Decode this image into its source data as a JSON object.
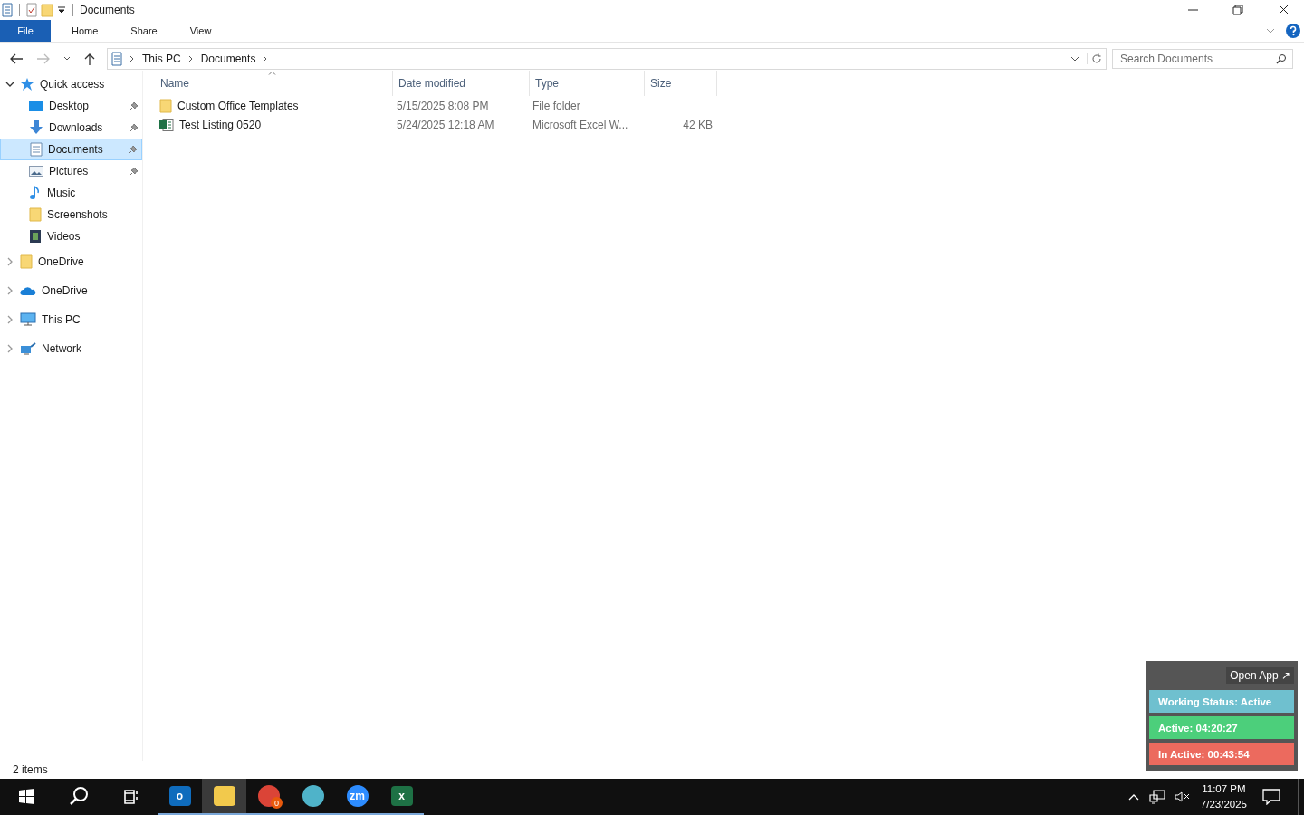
{
  "window": {
    "title": "Documents"
  },
  "ribbon_tabs": [
    {
      "label": "File",
      "kind": "file",
      "selected": false
    },
    {
      "label": "Home",
      "kind": "tab",
      "selected": false
    },
    {
      "label": "Share",
      "kind": "tab",
      "selected": false
    },
    {
      "label": "View",
      "kind": "tab",
      "selected": false
    }
  ],
  "breadcrumb": [
    "This PC",
    "Documents"
  ],
  "search": {
    "placeholder": "Search Documents"
  },
  "sidebar": {
    "items": [
      {
        "label": "Quick access",
        "kind": "star",
        "expanded": true,
        "selected": false,
        "children": [
          {
            "label": "Desktop",
            "kind": "desktop",
            "pinned": true,
            "selected": false
          },
          {
            "label": "Downloads",
            "kind": "download",
            "pinned": true,
            "selected": false
          },
          {
            "label": "Documents",
            "kind": "document",
            "pinned": true,
            "selected": true
          },
          {
            "label": "Pictures",
            "kind": "pictures",
            "pinned": true,
            "selected": false
          },
          {
            "label": "Music",
            "kind": "music",
            "pinned": false,
            "selected": false
          },
          {
            "label": "Screenshots",
            "kind": "folder",
            "pinned": false,
            "selected": false
          },
          {
            "label": "Videos",
            "kind": "video",
            "pinned": false,
            "selected": false
          }
        ]
      },
      {
        "label": "OneDrive",
        "kind": "folder",
        "expanded": false,
        "selected": false
      },
      {
        "label": "OneDrive",
        "kind": "cloud",
        "expanded": false,
        "selected": false
      },
      {
        "label": "This PC",
        "kind": "pc",
        "expanded": false,
        "selected": false
      },
      {
        "label": "Network",
        "kind": "network",
        "expanded": false,
        "selected": false
      }
    ]
  },
  "table": {
    "columns": [
      "Name",
      "Date modified",
      "Type",
      "Size"
    ],
    "rows": [
      {
        "kind": "folder",
        "name": "Custom Office Templates",
        "date": "5/15/2025 8:08 PM",
        "type": "File folder"
      },
      {
        "kind": "excel",
        "name": "Test Listing 0520",
        "date": "5/24/2025 12:18 AM",
        "type": "Microsoft Excel W...",
        "size": "42 KB"
      }
    ]
  },
  "status_bar": {
    "text": "2 items"
  },
  "tracker_widget": {
    "open_app": "Open App ↗",
    "rows": [
      {
        "text": "Working Status: Active",
        "color": "#6fc0cf"
      },
      {
        "text": "Active: 04:20:27",
        "color": "#4ccf7b"
      },
      {
        "text": "In Active: 00:43:54",
        "color": "#ec6a5e"
      }
    ]
  },
  "taskbar": {
    "apps": [
      {
        "kind": "outlook",
        "glyph": "o",
        "selected": false
      },
      {
        "kind": "explorer",
        "selected": true
      },
      {
        "kind": "chrome",
        "selected": false,
        "badge": "0"
      },
      {
        "kind": "diamond",
        "selected": false
      },
      {
        "kind": "zoom",
        "glyph": "zm",
        "selected": false
      },
      {
        "kind": "excel",
        "glyph": "x",
        "selected": false
      }
    ],
    "time": "11:07 PM",
    "date": "7/23/2025"
  }
}
